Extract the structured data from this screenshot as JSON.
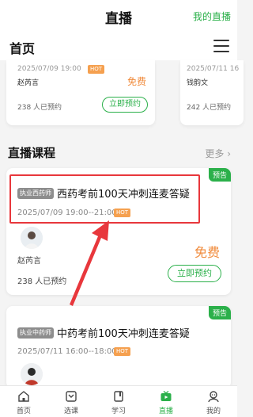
{
  "topbar": {
    "title": "直播",
    "my_live": "我的直播"
  },
  "header": {
    "home": "首页"
  },
  "top_cards": [
    {
      "date": "2025/07/09 19:00",
      "hot": "HOT",
      "teacher": "赵芮言",
      "free": "免费",
      "count": "238 人已预约",
      "reserve": "立即预约"
    },
    {
      "date": "2025/07/11 16",
      "teacher": "钱韵文",
      "count": "242 人已预约"
    }
  ],
  "section": {
    "title": "直播课程",
    "more": "更多"
  },
  "courses": [
    {
      "badge": "预告",
      "category": "执业西药师",
      "title": "西药考前100天冲刺连麦答疑",
      "time": "2025/07/09 19:00--21:00",
      "hot": "HOT",
      "teacher": "赵芮言",
      "free": "免费",
      "count": "238 人已预约",
      "reserve": "立即预约"
    },
    {
      "badge": "预告",
      "category": "执业中药师",
      "title": "中药考前100天冲刺连麦答疑",
      "time": "2025/07/11 16:00--18:00",
      "hot": "HOT"
    }
  ],
  "tabs": [
    {
      "label": "首页",
      "icon": "home-icon"
    },
    {
      "label": "选课",
      "icon": "course-select-icon"
    },
    {
      "label": "学习",
      "icon": "study-icon"
    },
    {
      "label": "直播",
      "icon": "live-icon",
      "active": true
    },
    {
      "label": "我的",
      "icon": "profile-icon"
    }
  ],
  "colors": {
    "accent": "#2bb04a",
    "hot": "#f5a04f",
    "free": "#f08a3a",
    "highlight": "#e8373c"
  }
}
